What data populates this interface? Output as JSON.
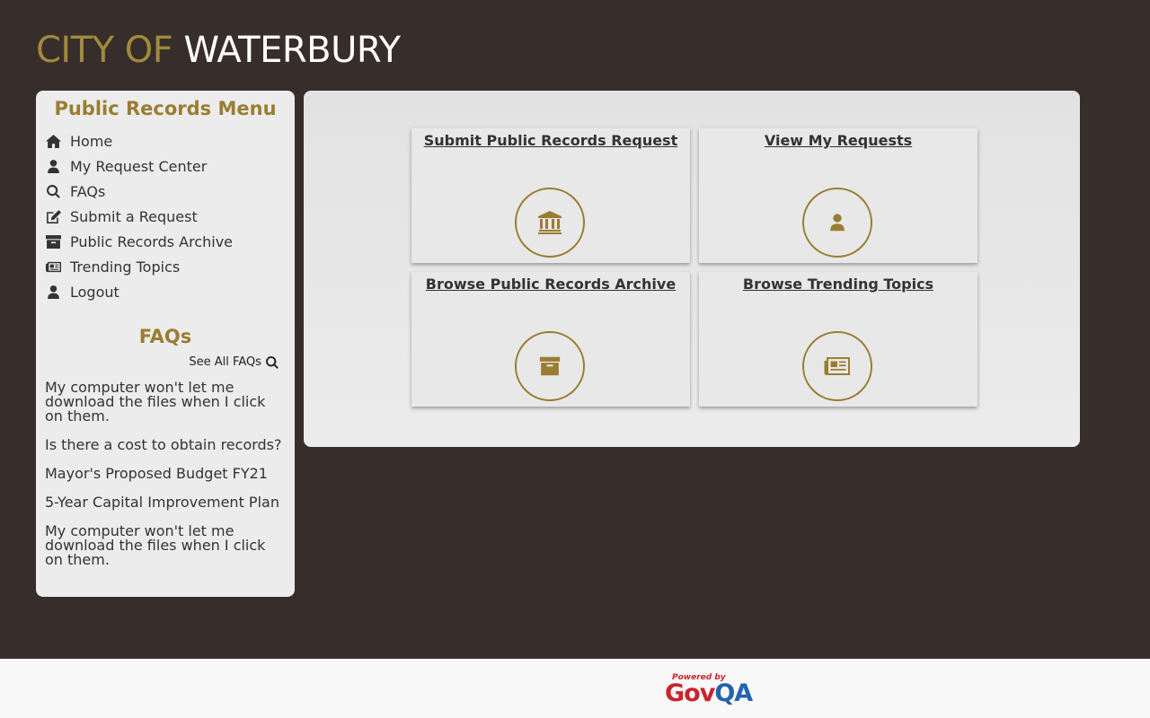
{
  "header": {
    "title_part1": "CITY OF",
    "title_part2": "WATERBURY"
  },
  "sidebar": {
    "menu_title": "Public Records Menu",
    "items": [
      {
        "label": "Home",
        "icon": "home-icon"
      },
      {
        "label": "My Request Center",
        "icon": "user-icon"
      },
      {
        "label": "FAQs",
        "icon": "search-icon"
      },
      {
        "label": "Submit a Request",
        "icon": "edit-icon"
      },
      {
        "label": "Public Records Archive",
        "icon": "archive-icon"
      },
      {
        "label": "Trending Topics",
        "icon": "newspaper-icon"
      },
      {
        "label": "Logout",
        "icon": "user-icon"
      }
    ],
    "faq_title": "FAQs",
    "see_all_label": "See All FAQs",
    "faqs": [
      "My computer won't let me download the files when I click on them.",
      "Is there a cost to obtain records?",
      "Mayor's Proposed Budget FY21",
      "5-Year Capital Improvement Plan",
      "My computer won't let me download the files when I click on them."
    ]
  },
  "tiles": [
    {
      "label": "Submit Public Records Request",
      "icon": "bank-icon"
    },
    {
      "label": "View My Requests",
      "icon": "user-icon"
    },
    {
      "label": "Browse Public Records Archive",
      "icon": "archive-icon"
    },
    {
      "label": "Browse Trending Topics",
      "icon": "newspaper-icon"
    }
  ],
  "footer": {
    "powered_by": "Powered by",
    "brand_gov": "Gov",
    "brand_qa": "QA"
  },
  "colors": {
    "background": "#372d2b",
    "accent": "#9a7d32",
    "panel": "#ececec",
    "footer": "#f8f8f8"
  }
}
